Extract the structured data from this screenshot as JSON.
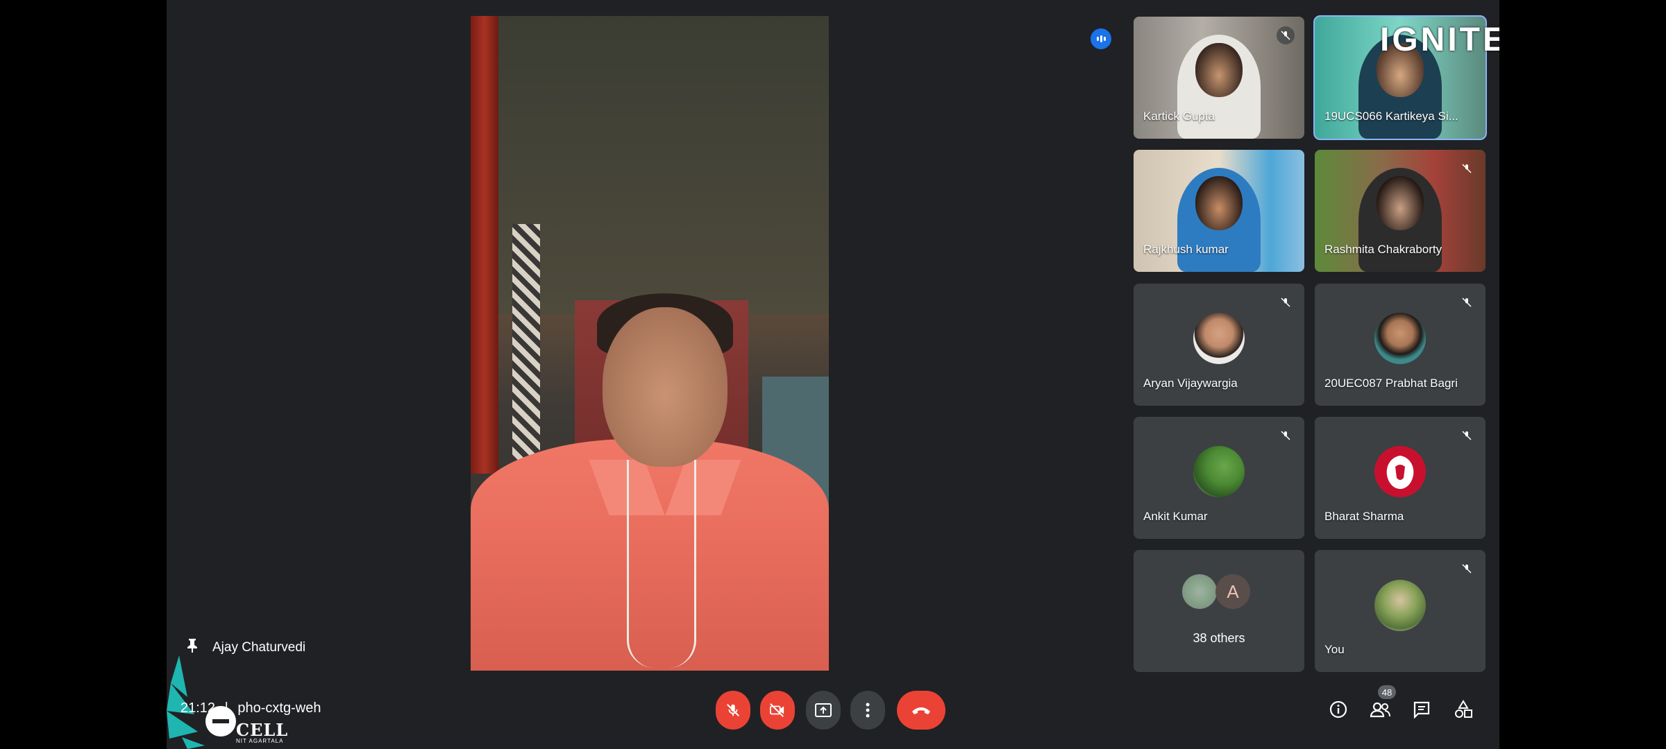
{
  "brand_overlay": "IGNITE",
  "pinned_speaker": {
    "name": "Ajay Chaturvedi"
  },
  "meeting": {
    "time": "21:12",
    "separator": "|",
    "code": "pho-cxtg-weh"
  },
  "logo": {
    "title": "CELL",
    "subtitle": "NIT AGARTALA"
  },
  "participants": [
    {
      "name": "Kartick Gupta",
      "muted": true,
      "video": true
    },
    {
      "name": "19UCS066 Kartikeya Si...",
      "muted": false,
      "video": true,
      "active": true
    },
    {
      "name": "Rajkhush kumar",
      "muted": false,
      "video": true
    },
    {
      "name": "Rashmita Chakraborty",
      "muted": true,
      "video": true
    },
    {
      "name": "Aryan Vijaywargia",
      "muted": true,
      "video": false
    },
    {
      "name": "20UEC087 Prabhat Bagri",
      "muted": true,
      "video": false
    },
    {
      "name": "Ankit Kumar",
      "muted": true,
      "video": false
    },
    {
      "name": "Bharat Sharma",
      "muted": true,
      "video": false
    },
    {
      "name": "38 others",
      "muted": false,
      "video": false,
      "avatar_letter": "A"
    },
    {
      "name": "You",
      "muted": true,
      "video": false
    }
  ],
  "controls": {
    "mic": "mic-off",
    "camera": "camera-off",
    "present": "present-screen",
    "more": "more-options",
    "end": "end-call"
  },
  "people_count": "48",
  "colors": {
    "background": "#202124",
    "danger": "#ea4335",
    "tile": "#3c4043",
    "active_border": "#8ab4f8",
    "speaking": "#1a73e8"
  }
}
